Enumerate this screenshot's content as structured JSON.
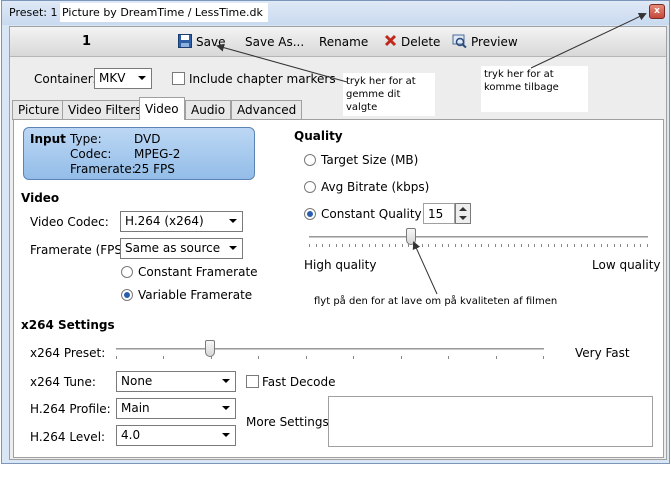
{
  "titlebar": {
    "preset_label": "Preset: 1",
    "preset_name": "Picture by DreamTime / LessTime.dk",
    "close_glyph": "x"
  },
  "toolbar": {
    "number": "1",
    "save": "Save",
    "save_as": "Save As...",
    "rename": "Rename",
    "delete": "Delete",
    "preview": "Preview"
  },
  "container": {
    "label": "Container:",
    "value": "MKV",
    "include_chapters": "Include chapter markers"
  },
  "tabs": [
    "Picture",
    "Video Filters",
    "Video",
    "Audio",
    "Advanced"
  ],
  "input_box": {
    "heading": "Input",
    "type_label": "Type:",
    "type_value": "DVD",
    "codec_label": "Codec:",
    "codec_value": "MPEG-2",
    "framerate_label": "Framerate:",
    "framerate_value": "25 FPS"
  },
  "video": {
    "heading": "Video",
    "codec_label": "Video Codec:",
    "codec_value": "H.264 (x264)",
    "fps_label": "Framerate (FPS):",
    "fps_value": "Same as source",
    "constant_framerate": "Constant Framerate",
    "variable_framerate": "Variable Framerate",
    "selected_framerate_mode": "Variable Framerate"
  },
  "quality": {
    "heading": "Quality",
    "target_size": "Target Size (MB)",
    "avg_bitrate": "Avg Bitrate (kbps)",
    "constant_quality": "Constant Quality",
    "selected_mode": "Constant Quality",
    "cq_value": "15",
    "high_label": "High quality",
    "low_label": "Low quality",
    "slider_position": 0.3
  },
  "x264": {
    "heading": "x264 Settings",
    "preset_label": "x264 Preset:",
    "preset_value": "Very Fast",
    "preset_slider_position": 0.22,
    "tune_label": "x264 Tune:",
    "tune_value": "None",
    "fast_decode": "Fast Decode",
    "profile_label": "H.264 Profile:",
    "profile_value": "Main",
    "level_label": "H.264 Level:",
    "level_value": "4.0",
    "more_settings": "More Settings:"
  },
  "notes": {
    "save_note": "tryk her for at gemme dit valgte",
    "back_note": "tryk her for at komme tilbage",
    "slider_note": "flyt på den for at lave om på kvaliteten af filmen"
  },
  "colors": {
    "accent": "#2a5fb0",
    "delete_red": "#c0281c",
    "info_box": "#a9cdf0"
  }
}
